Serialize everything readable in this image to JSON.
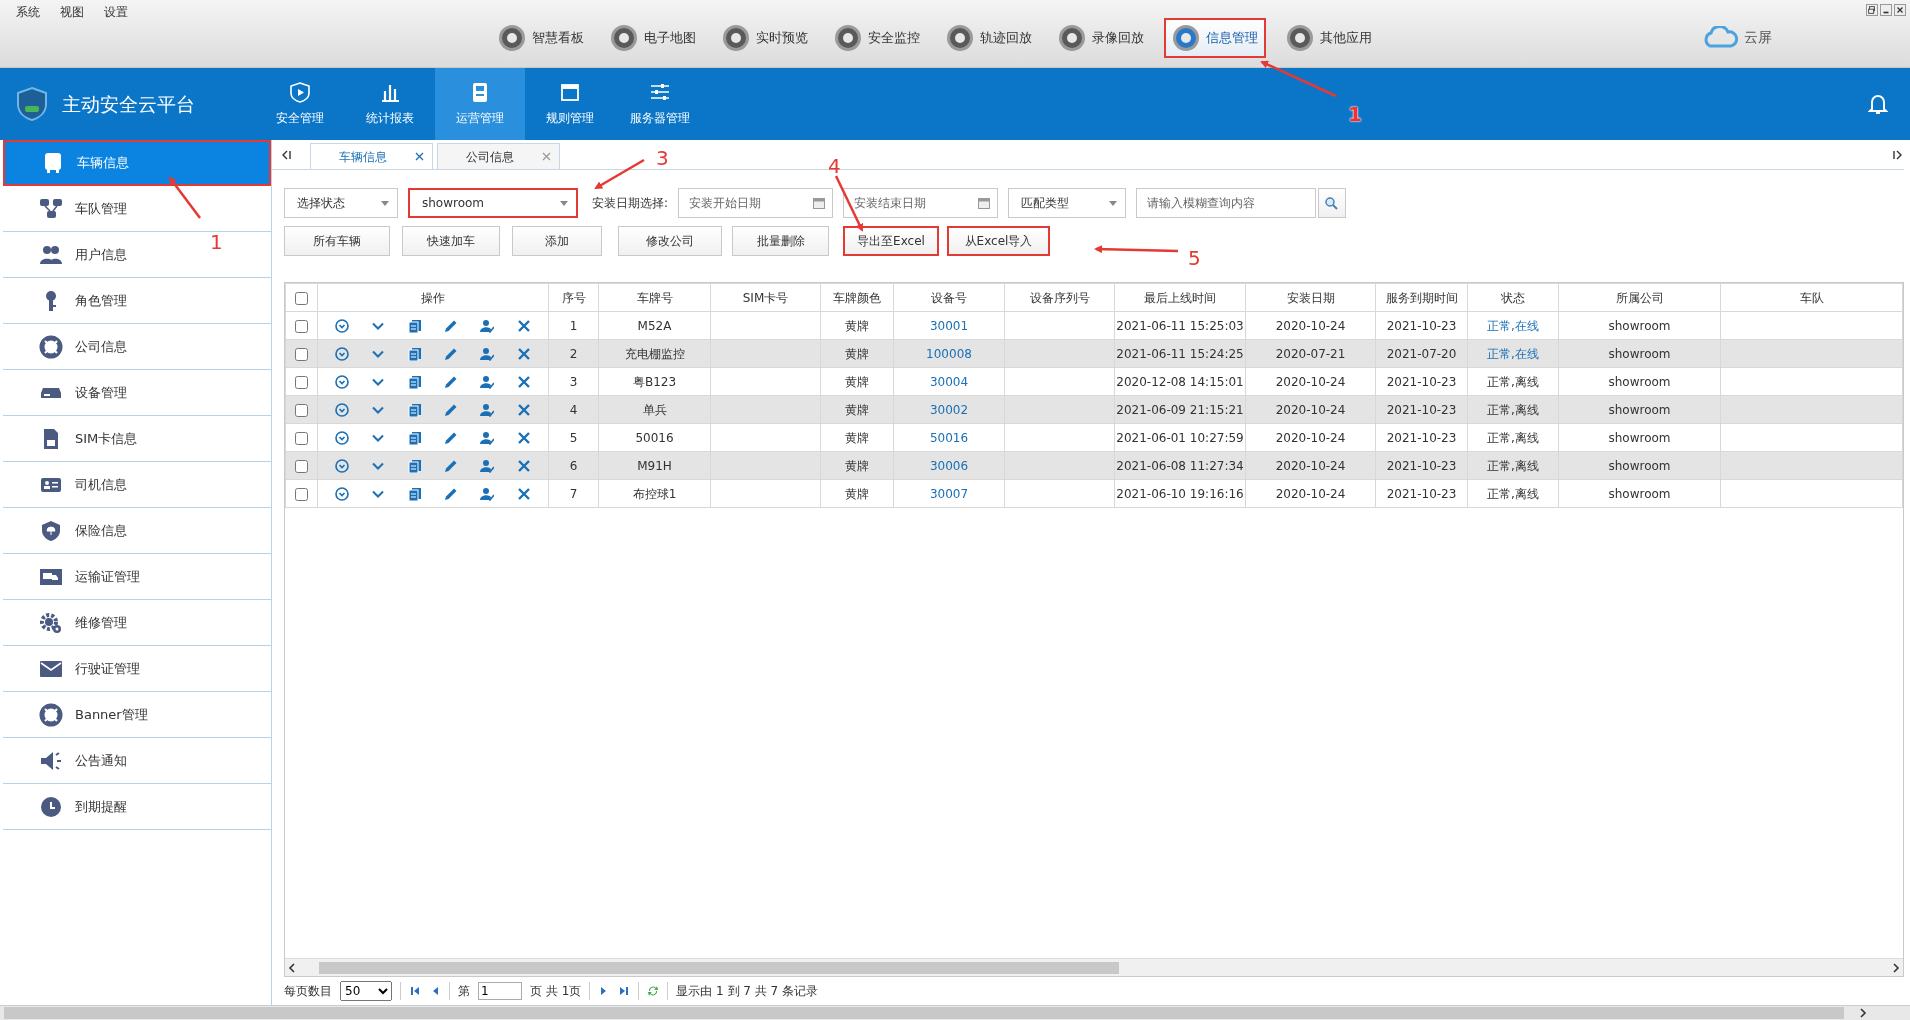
{
  "menu": [
    "系统",
    "视图",
    "设置"
  ],
  "toolbar": [
    {
      "label": "智慧看板",
      "selected": false,
      "highlighted": false
    },
    {
      "label": "电子地图",
      "selected": false,
      "highlighted": false
    },
    {
      "label": "实时预览",
      "selected": false,
      "highlighted": false
    },
    {
      "label": "安全监控",
      "selected": false,
      "highlighted": false
    },
    {
      "label": "轨迹回放",
      "selected": false,
      "highlighted": false
    },
    {
      "label": "录像回放",
      "selected": false,
      "highlighted": false
    },
    {
      "label": "信息管理",
      "selected": true,
      "highlighted": true
    },
    {
      "label": "其他应用",
      "selected": false,
      "highlighted": false
    }
  ],
  "brand": "云屏",
  "header": {
    "title": "主动安全云平台",
    "nav": [
      {
        "label": "安全管理",
        "selected": false
      },
      {
        "label": "统计报表",
        "selected": false
      },
      {
        "label": "运营管理",
        "selected": true
      },
      {
        "label": "规则管理",
        "selected": false
      },
      {
        "label": "服务器管理",
        "selected": false
      }
    ]
  },
  "sidebar": {
    "items": [
      {
        "label": "车辆信息",
        "selected": true,
        "highlighted": true
      },
      {
        "label": "车队管理",
        "selected": false,
        "highlighted": false
      },
      {
        "label": "用户信息",
        "selected": false,
        "highlighted": false
      },
      {
        "label": "角色管理",
        "selected": false,
        "highlighted": false
      },
      {
        "label": "公司信息",
        "selected": false,
        "highlighted": false
      },
      {
        "label": "设备管理",
        "selected": false,
        "highlighted": false
      },
      {
        "label": "SIM卡信息",
        "selected": false,
        "highlighted": false
      },
      {
        "label": "司机信息",
        "selected": false,
        "highlighted": false
      },
      {
        "label": "保险信息",
        "selected": false,
        "highlighted": false
      },
      {
        "label": "运输证管理",
        "selected": false,
        "highlighted": false
      },
      {
        "label": "维修管理",
        "selected": false,
        "highlighted": false
      },
      {
        "label": "行驶证管理",
        "selected": false,
        "highlighted": false
      },
      {
        "label": "Banner管理",
        "selected": false,
        "highlighted": false
      },
      {
        "label": "公告通知",
        "selected": false,
        "highlighted": false
      },
      {
        "label": "到期提醒",
        "selected": false,
        "highlighted": false
      }
    ]
  },
  "tabs": [
    {
      "label": "车辆信息",
      "selected": true
    },
    {
      "label": "公司信息",
      "selected": false
    }
  ],
  "filters": {
    "status_select": "选择状态",
    "company_select": {
      "value": "showroom",
      "highlighted": true
    },
    "date_label": "安装日期选择:",
    "start_date": {
      "placeholder": "安装开始日期"
    },
    "end_date": {
      "placeholder": "安装结束日期"
    },
    "match_select": "匹配类型",
    "search": {
      "placeholder": "请输入模糊查询内容"
    }
  },
  "buttons": [
    {
      "label": "所有车辆",
      "highlighted": false
    },
    {
      "label": "快速加车",
      "highlighted": false
    },
    {
      "label": "添加",
      "highlighted": false
    },
    {
      "label": "修改公司",
      "highlighted": false
    },
    {
      "label": "批量删除",
      "highlighted": false
    },
    {
      "label": "导出至Excel",
      "highlighted": true
    },
    {
      "label": "从Excel导入",
      "highlighted": true
    }
  ],
  "table": {
    "select_all": {
      "checked": false
    },
    "columns": [
      "操作",
      "序号",
      "车牌号",
      "SIM卡号",
      "车牌颜色",
      "设备号",
      "设备序列号",
      "最后上线时间",
      "安装日期",
      "服务到期时间",
      "状态",
      "所属公司",
      "车队"
    ],
    "rows": [
      {
        "checked": false,
        "no": "1",
        "plate": "M52A",
        "plate_color": "黄牌",
        "device": "30001",
        "last_online": "2021-06-11 15:25:03",
        "install_date": "2020-10-24",
        "expiry": "2021-10-23",
        "status": "正常,在线",
        "online": true,
        "company": "showroom"
      },
      {
        "checked": false,
        "no": "2",
        "plate": "充电棚监控",
        "plate_color": "黄牌",
        "device": "100008",
        "last_online": "2021-06-11 15:24:25",
        "install_date": "2020-07-21",
        "expiry": "2021-07-20",
        "status": "正常,在线",
        "online": true,
        "company": "showroom"
      },
      {
        "checked": false,
        "no": "3",
        "plate": "粤B123",
        "plate_color": "黄牌",
        "device": "30004",
        "last_online": "2020-12-08 14:15:01",
        "install_date": "2020-10-24",
        "expiry": "2021-10-23",
        "status": "正常,离线",
        "online": false,
        "company": "showroom"
      },
      {
        "checked": false,
        "no": "4",
        "plate": "单兵",
        "plate_color": "黄牌",
        "device": "30002",
        "last_online": "2021-06-09 21:15:21",
        "install_date": "2020-10-24",
        "expiry": "2021-10-23",
        "status": "正常,离线",
        "online": false,
        "company": "showroom"
      },
      {
        "checked": false,
        "no": "5",
        "plate": "50016",
        "plate_color": "黄牌",
        "device": "50016",
        "last_online": "2021-06-01 10:27:59",
        "install_date": "2020-10-24",
        "expiry": "2021-10-23",
        "status": "正常,离线",
        "online": false,
        "company": "showroom"
      },
      {
        "checked": false,
        "no": "6",
        "plate": "M91H",
        "plate_color": "黄牌",
        "device": "30006",
        "last_online": "2021-06-08 11:27:34",
        "install_date": "2020-10-24",
        "expiry": "2021-10-23",
        "status": "正常,离线",
        "online": false,
        "company": "showroom"
      },
      {
        "checked": false,
        "no": "7",
        "plate": "布控球1",
        "plate_color": "黄牌",
        "device": "30007",
        "last_online": "2021-06-10 19:16:16",
        "install_date": "2020-10-24",
        "expiry": "2021-10-23",
        "status": "正常,离线",
        "online": false,
        "company": "showroom"
      }
    ]
  },
  "pager": {
    "page_size_label": "每页数目",
    "page_size": "50",
    "page_label": "第",
    "page": "1",
    "page_suffix": "页 共 1页",
    "summary": "显示由 1 到 7 共 7 条记录"
  },
  "annotations": [
    {
      "number": "1"
    },
    {
      "number": "1"
    },
    {
      "number": "3"
    },
    {
      "number": "4"
    },
    {
      "number": "5"
    }
  ]
}
